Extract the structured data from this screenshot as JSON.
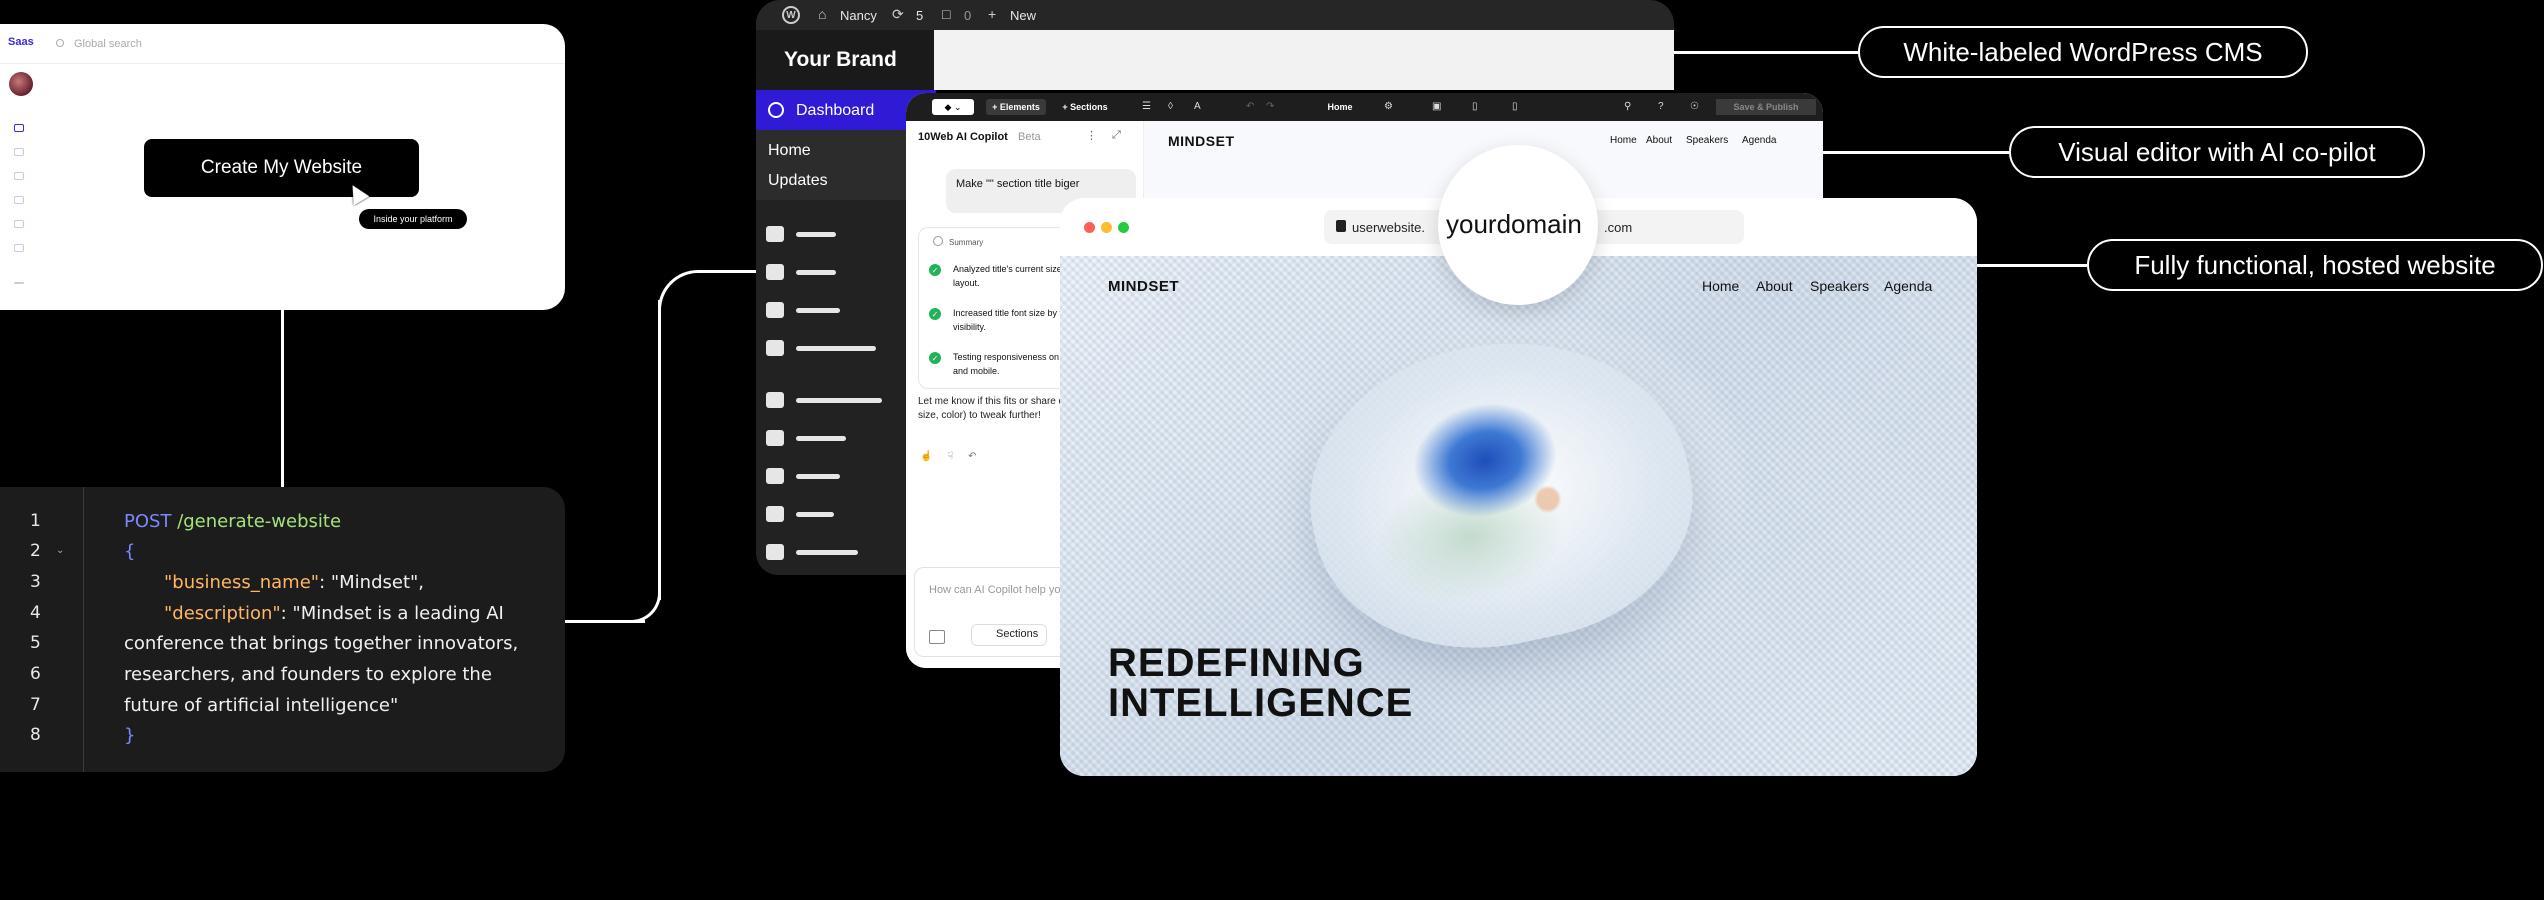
{
  "saas": {
    "logo": "Saas",
    "search_placeholder": "Global search",
    "create_button": "Create My Website",
    "cursor_tooltip": "Inside your platform"
  },
  "code": {
    "line_numbers": [
      "1",
      "2",
      "3",
      "4",
      "5",
      "6",
      "7",
      "8"
    ],
    "method": "POST",
    "path": "/generate-website",
    "open_brace": "{",
    "close_brace": "}",
    "key_name": "\"business_name\"",
    "colon_name": ": \"Mindset\",",
    "key_desc": "\"description\"",
    "desc_1": ": \"Mindset is a leading AI",
    "desc_2": "conference that brings together innovators,",
    "desc_3": "researchers, and founders to explore the",
    "desc_4": "future of artificial intelligence\""
  },
  "wp": {
    "site_name": "Nancy",
    "updates_count": "5",
    "comments_count": "0",
    "new_label": "New",
    "brand": "Your Brand",
    "dashboard": "Dashboard",
    "sub_home": "Home",
    "sub_updates": "Updates"
  },
  "editor": {
    "elements": "+ Elements",
    "sections": "+ Sections",
    "page": "Home",
    "save": "Save & Publish",
    "copilot_title": "10Web AI Copilot",
    "copilot_beta": "Beta",
    "user_message": "Make \"\" section title biger",
    "summary_title": "Summary",
    "steps": [
      "Analyzed title's current size and layout.",
      "Increased title font size by for better visibility.",
      "Testing responsiveness on desktop and mobile."
    ],
    "reply": "Let me know if this fits or share details (e.g., size, color) to tweak further!",
    "input_placeholder": "How can AI Copilot help you?",
    "input_sections": "Sections",
    "preview_brand": "MINDSET",
    "preview_nav": [
      "Home",
      "About",
      "Speakers",
      "Agenda"
    ]
  },
  "site": {
    "url_prefix": "userwebsite.",
    "url_suffix": ".com",
    "magnified_domain": "yourdomain",
    "brand": "MINDSET",
    "nav": [
      "Home",
      "About",
      "Speakers",
      "Agenda"
    ],
    "hero_line1": "REDEFINING",
    "hero_line2": "INTELLIGENCE"
  },
  "tags": {
    "cms": "White-labeled WordPress CMS",
    "editor": "Visual editor with AI co-pilot",
    "hosted": "Fully functional, hosted website"
  },
  "colors": {
    "accent_purple": "#2f1bd6",
    "check_green": "#22b35a",
    "code_keyword": "#7d88ff",
    "code_path": "#a6e27a",
    "code_key": "#ffb763"
  }
}
